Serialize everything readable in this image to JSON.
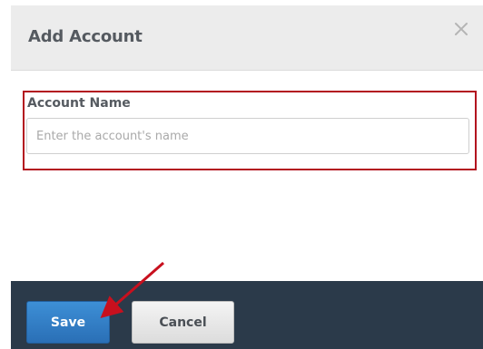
{
  "dialog": {
    "title": "Add Account",
    "close_icon": "close-icon"
  },
  "form": {
    "account_name_label": "Account Name",
    "account_name_placeholder": "Enter the account's name",
    "account_name_value": ""
  },
  "footer": {
    "save_label": "Save",
    "cancel_label": "Cancel"
  },
  "colors": {
    "header_bg": "#ececec",
    "footer_bg": "#2b3a4a",
    "save_button": "#2a6fb6",
    "highlight": "#b3121f",
    "title_text": "#555a60"
  }
}
